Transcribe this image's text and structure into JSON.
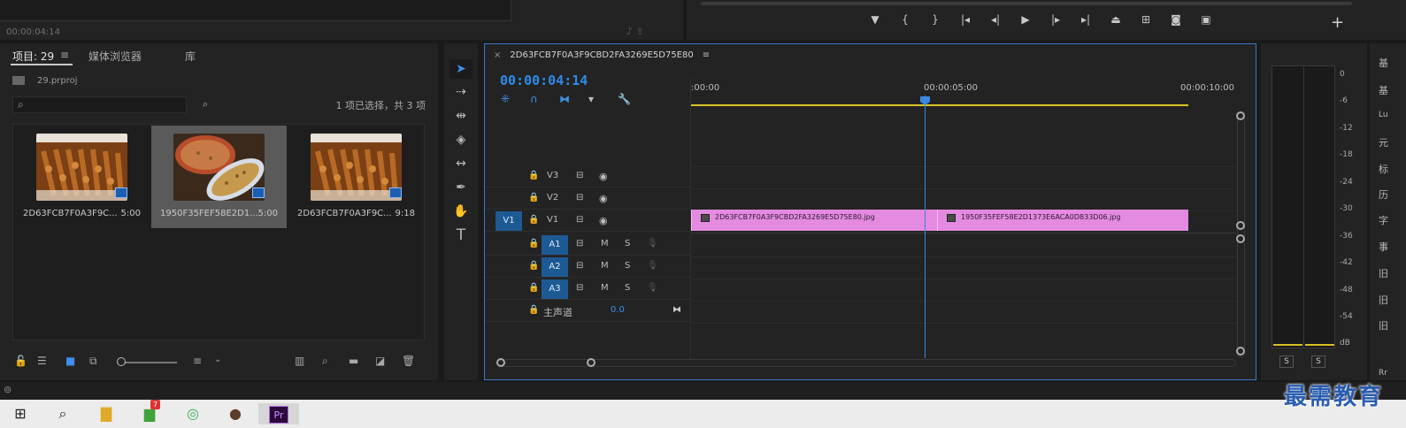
{
  "source_monitor": {
    "timecode": "00:00:04:14"
  },
  "program_monitor": {
    "transport_icons": [
      "marker-icon",
      "mark-in-icon",
      "mark-out-icon",
      "go-to-in-icon",
      "step-back-icon",
      "play-icon",
      "step-forward-icon",
      "go-to-out-icon",
      "lift-icon",
      "extract-icon",
      "export-frame-icon",
      "compare-icon"
    ],
    "add_label": "+"
  },
  "project_panel": {
    "tabs": [
      "项目: 29",
      "媒体浏览器",
      "库"
    ],
    "menu_icon": "≡",
    "file": "29.prproj",
    "search_value": "",
    "selection_status": "1 项已选择，共 3 项",
    "items": [
      {
        "name": "2D63FCB7F0A3F9C...",
        "duration": "5:00",
        "selected": false
      },
      {
        "name": "1950F35FEF58E2D1...",
        "duration": "5:00",
        "selected": true
      },
      {
        "name": "2D63FCB7F0A3F9C...",
        "duration": "9:18",
        "selected": false
      }
    ]
  },
  "timeline": {
    "sequence_name": "2D63FCB7F0A3F9CBD2FA3269E5D75E80",
    "timecode": "00:00:04:14",
    "ruler_labels": [
      ":00:00",
      "00:00:05:00",
      "00:00:10:00"
    ],
    "tracks": {
      "video": [
        {
          "name": "V3",
          "source": ""
        },
        {
          "name": "V2",
          "source": ""
        },
        {
          "name": "V1",
          "source": "V1"
        }
      ],
      "audio": [
        {
          "name": "A1",
          "mute": "M",
          "solo": "S"
        },
        {
          "name": "A2",
          "mute": "M",
          "solo": "S"
        },
        {
          "name": "A3",
          "mute": "M",
          "solo": "S"
        }
      ],
      "master": {
        "name": "主声道",
        "value": "0.0"
      }
    },
    "clips": [
      {
        "name": "2D63FCB7F0A3F9CBD2FA3269E5D75E80.jpg"
      },
      {
        "name": "1950F35FEF58E2D1373E6ACA0D833D06.jpg"
      }
    ]
  },
  "audio_meter": {
    "scale": [
      "0",
      "-6",
      "-12",
      "-18",
      "-24",
      "-30",
      "-36",
      "-42",
      "-48",
      "-54",
      "dB"
    ],
    "solo_labels": [
      "S",
      "S"
    ]
  },
  "right_sidebar": [
    "基",
    "基",
    "Lu",
    "元",
    "标",
    "历",
    "字",
    "事",
    "旧",
    "旧",
    "旧",
    "Rr"
  ],
  "watermark": "最需教育",
  "taskbar": {
    "premiere_label": "Pr",
    "badge": "7"
  }
}
